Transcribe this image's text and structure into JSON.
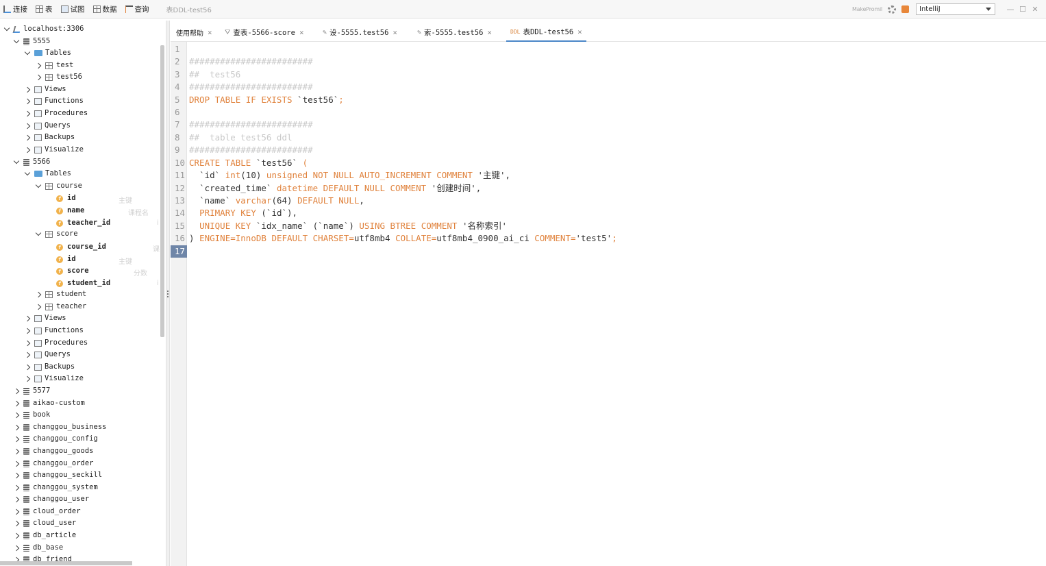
{
  "toolbar": {
    "buttons": [
      {
        "label": "连接",
        "icon": "connect-icon"
      },
      {
        "label": "表",
        "icon": "table-icon"
      },
      {
        "label": "试图",
        "icon": "view-icon"
      },
      {
        "label": "数据",
        "icon": "data-icon"
      },
      {
        "label": "查询",
        "icon": "query-icon"
      }
    ],
    "doc_title": "表DDL-test56",
    "brand": "MakePromil",
    "theme_select": "IntelliJ",
    "window_min": "—",
    "window_max": "☐",
    "window_close": "✕"
  },
  "tree": {
    "root": "localhost:3306",
    "db_5555": "5555",
    "db_5566": "5566",
    "tables_label": "Tables",
    "views_label": "Views",
    "functions_label": "Functions",
    "procedures_label": "Procedures",
    "querys_label": "Querys",
    "backups_label": "Backups",
    "visualize_label": "Visualize",
    "t_test": "test",
    "t_test56": "test56",
    "t_course": "course",
    "course_fields": [
      {
        "name": "id",
        "comment": "主键"
      },
      {
        "name": "name",
        "comment": "课程名"
      },
      {
        "name": "teacher_id",
        "comment": "i"
      }
    ],
    "t_score": "score",
    "score_fields": [
      {
        "name": "course_id",
        "comment": "课"
      },
      {
        "name": "id",
        "comment": "主键"
      },
      {
        "name": "score",
        "comment": "分数"
      },
      {
        "name": "student_id",
        "comment": "i"
      }
    ],
    "t_student": "student",
    "t_teacher": "teacher",
    "other_dbs": [
      "5577",
      "aikao-custom",
      "book",
      "changgou_business",
      "changgou_config",
      "changgou_goods",
      "changgou_order",
      "changgou_seckill",
      "changgou_system",
      "changgou_user",
      "cloud_order",
      "cloud_user",
      "db_article",
      "db_base",
      "db_friend"
    ]
  },
  "tabs": [
    {
      "label": "使用帮助",
      "icon": ""
    },
    {
      "label": "查表-5566-score",
      "icon": "query-icon"
    },
    {
      "label": "设-5555.test56",
      "icon": "pencil-icon"
    },
    {
      "label": "索-5555.test56",
      "icon": "pencil-icon"
    },
    {
      "label": "表DDL-test56",
      "icon": "ddl-icon"
    }
  ],
  "editor": {
    "line_numbers": [
      "1",
      "2",
      "3",
      "4",
      "5",
      "6",
      "7",
      "8",
      "9",
      "10",
      "11",
      "12",
      "13",
      "14",
      "15",
      "16",
      "17"
    ],
    "current_line": "17"
  }
}
